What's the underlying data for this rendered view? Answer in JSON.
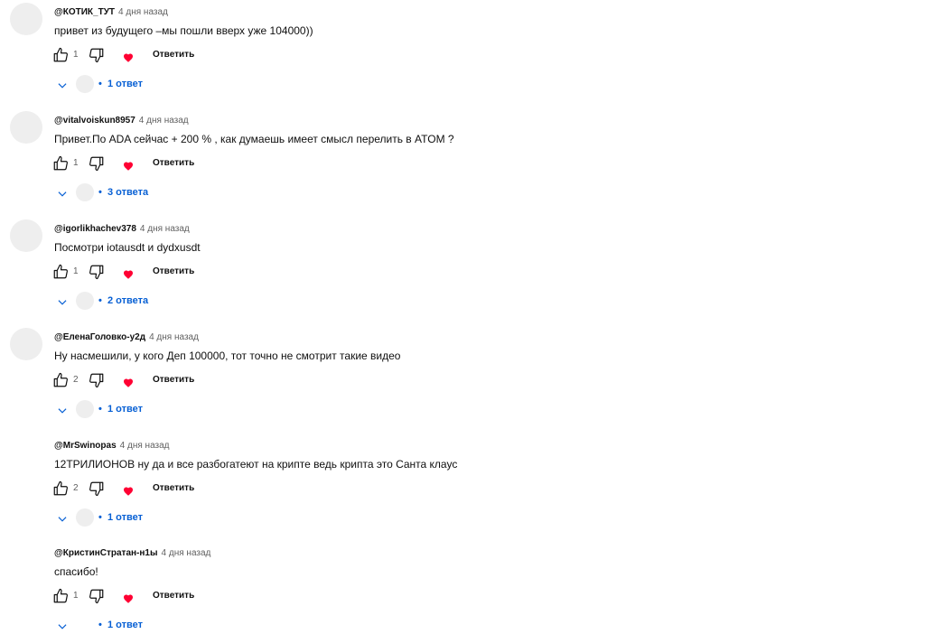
{
  "comments": [
    {
      "author": "@КОТИК_ТУТ",
      "time": "4 дня назад",
      "text": "привет из будущего –мы пошли вверх уже 104000))",
      "likes": "1",
      "reply_label": "Ответить",
      "replies": "1 ответ"
    },
    {
      "author": "@vitalvoiskun8957",
      "time": "4 дня назад",
      "text": "Привет.По ADA сейчас + 200 % , как думаешь имеет смысл перелить в ATOM ?",
      "likes": "1",
      "reply_label": "Ответить",
      "replies": "3 ответа"
    },
    {
      "author": "@igorlikhachev378",
      "time": "4 дня назад",
      "text": "Посмотри iotausdt и dydxusdt",
      "likes": "1",
      "reply_label": "Ответить",
      "replies": "2 ответа"
    },
    {
      "author": "@ЕленаГоловко-у2д",
      "time": "4 дня назад",
      "text": "Ну насмешили, у кого Деп 100000, тот точно не смотрит такие видео",
      "likes": "2",
      "reply_label": "Ответить",
      "replies": "1 ответ"
    },
    {
      "author": "@MrSwinopas",
      "time": "4 дня назад",
      "text": "12ТРИЛИОНОВ ну да и все разбогатеют на крипте ведь крипта это Санта клаус",
      "likes": "2",
      "reply_label": "Ответить",
      "replies": "1 ответ"
    },
    {
      "author": "@КристинСтратан-н1ы",
      "time": "4 дня назад",
      "text": "спасибо!",
      "likes": "1",
      "reply_label": "Ответить",
      "replies": "1 ответ"
    }
  ],
  "icons": {
    "like": "thumb-up-icon",
    "dislike": "thumb-down-icon",
    "heart": "heart-icon",
    "chevron": "chevron-down-icon"
  },
  "colors": {
    "link": "#065fd4",
    "heart": "#ff0033",
    "meta": "#606060"
  }
}
